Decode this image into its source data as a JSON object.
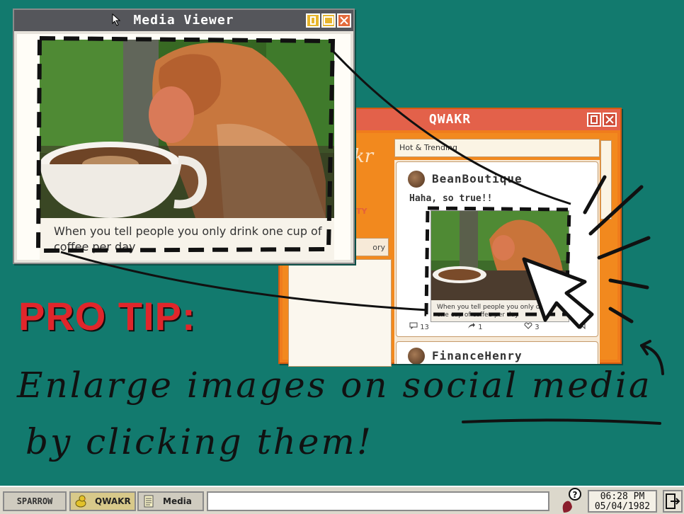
{
  "qwakr": {
    "title": "QWAKR",
    "tab_label": "Hot & Trending",
    "side_pill": "ory",
    "side_mark": "TY",
    "side_logo": "kr",
    "post": {
      "author": "BeanBoutique",
      "text": "Haha, so true!!",
      "image_caption": "When you tell people you only drink one cup of coffee per day",
      "comments": "13",
      "shares": "1",
      "likes": "3"
    },
    "next_post_author": "FinanceHenry"
  },
  "media_viewer": {
    "title": "Media Viewer",
    "caption": "When you tell people you only drink one cup of coffee per day"
  },
  "annotation": {
    "heading": "PRO TIP:",
    "line1_a": "Enlarge images on ",
    "line1_b": "social media",
    "line2": "by clicking them!"
  },
  "taskbar": {
    "start_label": "SPARROW",
    "tasks": [
      {
        "label": "QWAKR",
        "icon": "duck-icon"
      },
      {
        "label": "Media",
        "icon": "document-icon"
      }
    ],
    "clock_time": "06:28 PM",
    "clock_date": "05/04/1982",
    "colors": {
      "accent": "#f07c1c",
      "titlebar": "#e3614a",
      "desktop": "#127a6e"
    }
  }
}
